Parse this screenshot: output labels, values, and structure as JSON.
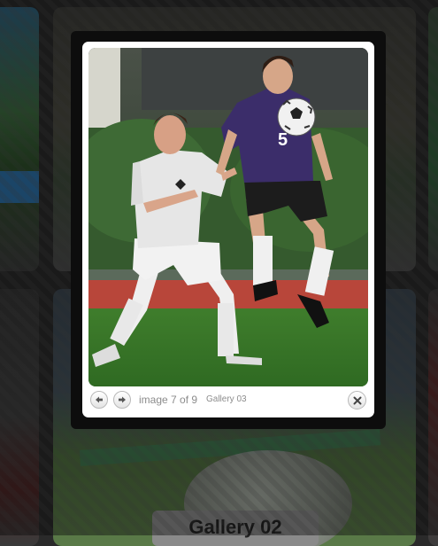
{
  "background": {
    "caption": "Gallery 02"
  },
  "lightbox": {
    "photo_alt": "Two soccer players competing for the ball",
    "counter": "image 7 of 9",
    "gallery": "Gallery 03",
    "icons": {
      "prev": "left-arrow-icon",
      "next": "right-arrow-icon",
      "close": "close-icon"
    },
    "jersey_number": "5"
  }
}
